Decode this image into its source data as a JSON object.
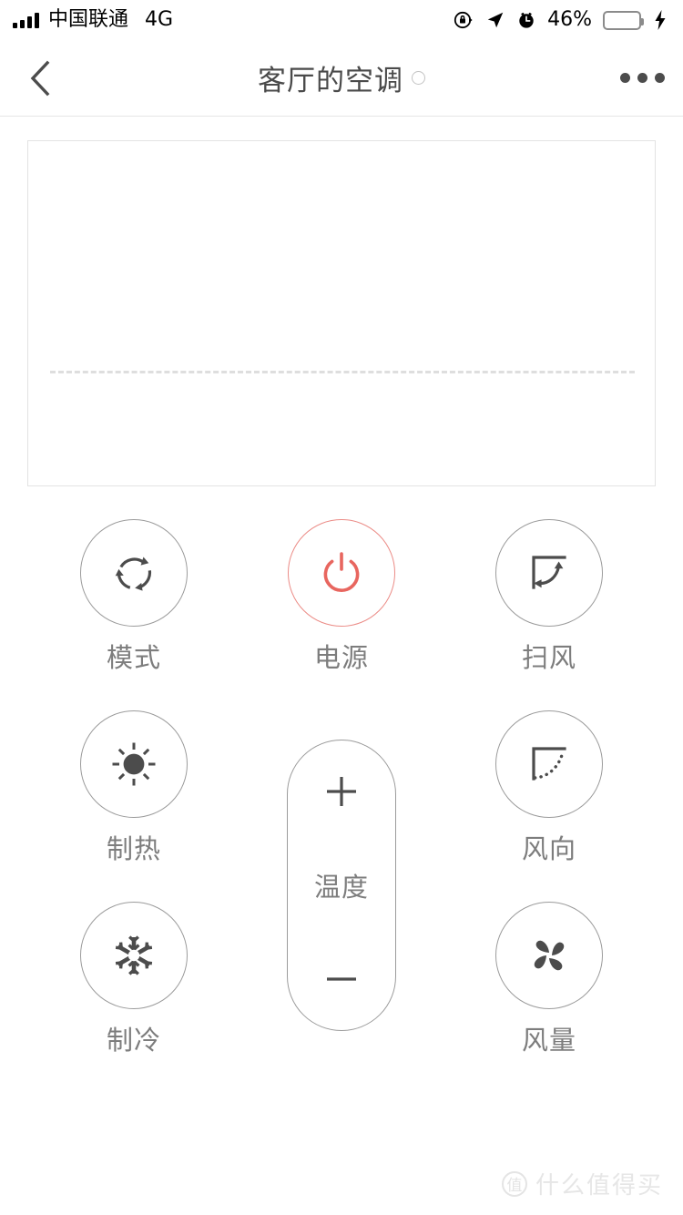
{
  "status_bar": {
    "carrier": "中国联通",
    "network_type": "4G",
    "battery_percent": "46%",
    "battery_level": 46,
    "icons": [
      "signal-bars-icon",
      "rotation-lock-icon",
      "location-arrow-icon",
      "alarm-clock-icon",
      "battery-icon",
      "charging-bolt-icon"
    ],
    "battery_color": "#5fd35f"
  },
  "nav_bar": {
    "back_label": "‹",
    "title": "客厅的空调",
    "status_dot": "",
    "more_label": "•••"
  },
  "display_panel": {
    "content": ""
  },
  "controls": {
    "rows": [
      {
        "left": {
          "label": "模式",
          "icon": "mode-cycle-icon",
          "accent": "#4c4c4c"
        },
        "center": {
          "label": "电源",
          "icon": "power-icon",
          "accent": "#e8665f"
        },
        "right": {
          "label": "扫风",
          "icon": "swing-icon",
          "accent": "#4c4c4c"
        }
      },
      {
        "left": {
          "label": "制热",
          "icon": "sun-icon",
          "accent": "#4c4c4c"
        },
        "right": {
          "label": "风向",
          "icon": "wind-direction-icon",
          "accent": "#4c4c4c"
        }
      },
      {
        "left": {
          "label": "制冷",
          "icon": "snowflake-icon",
          "accent": "#4c4c4c"
        },
        "right": {
          "label": "风量",
          "icon": "fan-icon",
          "accent": "#4c4c4c"
        }
      }
    ]
  },
  "temperature": {
    "label": "温度",
    "increase_icon": "plus-icon",
    "decrease_icon": "minus-icon"
  },
  "watermark": {
    "badge": "值",
    "text": "什么值得买"
  },
  "colors": {
    "power_accent": "#e8665f",
    "icon_gray": "#4c4c4c",
    "label_gray": "#7d7d7d",
    "border_gray": "#9b9b9b",
    "panel_border": "#e3e3e3"
  }
}
